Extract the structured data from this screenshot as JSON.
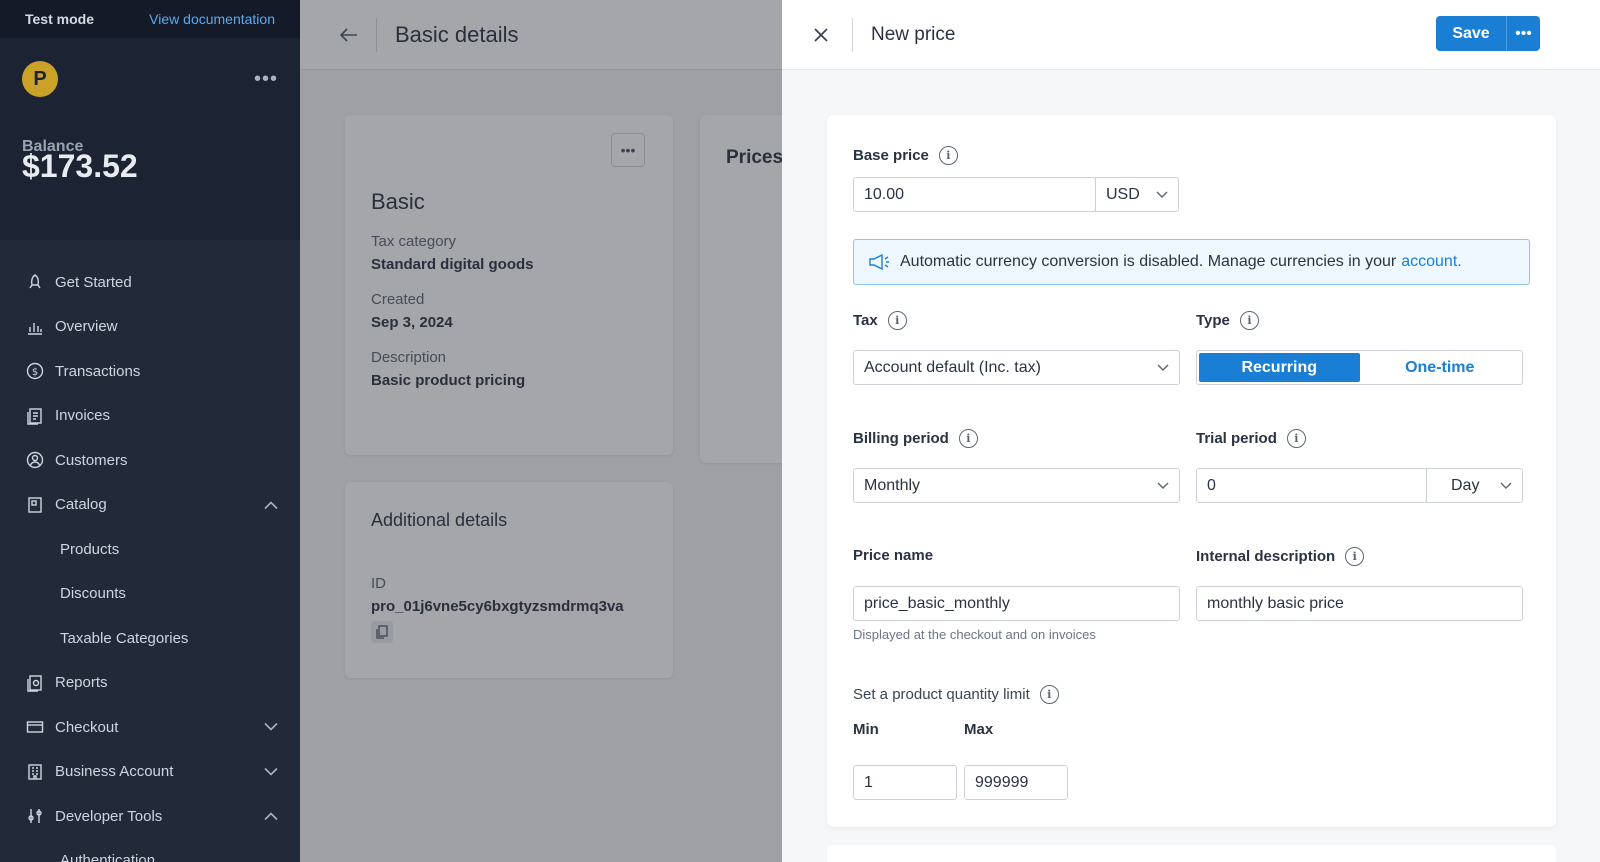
{
  "topbar": {
    "mode": "Test mode",
    "docs_link": "View documentation"
  },
  "brand": {
    "logo_letter": "P"
  },
  "balance": {
    "label": "Balance",
    "amount": "$173.52"
  },
  "sidebar": {
    "items": [
      {
        "label": "Get Started",
        "icon": "rocket-icon"
      },
      {
        "label": "Overview",
        "icon": "chart-icon"
      },
      {
        "label": "Transactions",
        "icon": "dollar-icon"
      },
      {
        "label": "Invoices",
        "icon": "invoice-icon"
      },
      {
        "label": "Customers",
        "icon": "user-icon"
      },
      {
        "label": "Catalog",
        "icon": "catalog-icon",
        "expanded": true
      },
      {
        "label": "Products"
      },
      {
        "label": "Discounts"
      },
      {
        "label": "Taxable Categories"
      },
      {
        "label": "Reports",
        "icon": "reports-icon"
      },
      {
        "label": "Checkout",
        "icon": "card-icon",
        "expanded": false
      },
      {
        "label": "Business Account",
        "icon": "building-icon",
        "expanded": false
      },
      {
        "label": "Developer Tools",
        "icon": "tools-icon",
        "expanded": true
      },
      {
        "label": "Authentication"
      }
    ]
  },
  "middle": {
    "title": "Basic details",
    "product_card": {
      "name": "Basic",
      "tax_category_label": "Tax category",
      "tax_category_value": "Standard digital goods",
      "created_label": "Created",
      "created_value": "Sep 3, 2024",
      "description_label": "Description",
      "description_value": "Basic product pricing"
    },
    "prices_card": {
      "title": "Prices"
    },
    "additional_card": {
      "title": "Additional details",
      "id_label": "ID",
      "id_value": "pro_01j6vne5cy6bxgtyzsmdrmq3va"
    }
  },
  "drawer": {
    "title": "New price",
    "save_label": "Save",
    "base_price": {
      "label": "Base price",
      "value": "10.00",
      "currency": "USD"
    },
    "notice": {
      "text": "Automatic currency conversion is disabled. Manage currencies in your",
      "link": "account."
    },
    "tax": {
      "label": "Tax",
      "value": "Account default (Inc. tax)"
    },
    "type": {
      "label": "Type",
      "options": [
        "Recurring",
        "One-time"
      ],
      "selected": "Recurring"
    },
    "billing_period": {
      "label": "Billing period",
      "value": "Monthly"
    },
    "trial_period": {
      "label": "Trial period",
      "value": "0",
      "unit": "Day"
    },
    "price_name": {
      "label": "Price name",
      "value": "price_basic_monthly",
      "hint": "Displayed at the checkout and on invoices"
    },
    "internal_description": {
      "label": "Internal description",
      "value": "monthly basic price"
    },
    "quantity_limit": {
      "label": "Set a product quantity limit",
      "min_label": "Min",
      "min_value": "1",
      "max_label": "Max",
      "max_value": "999999"
    }
  },
  "colors": {
    "accent": "#1a7fd4",
    "sidebar_bg": "#1c2333",
    "logo": "#c9a227"
  }
}
